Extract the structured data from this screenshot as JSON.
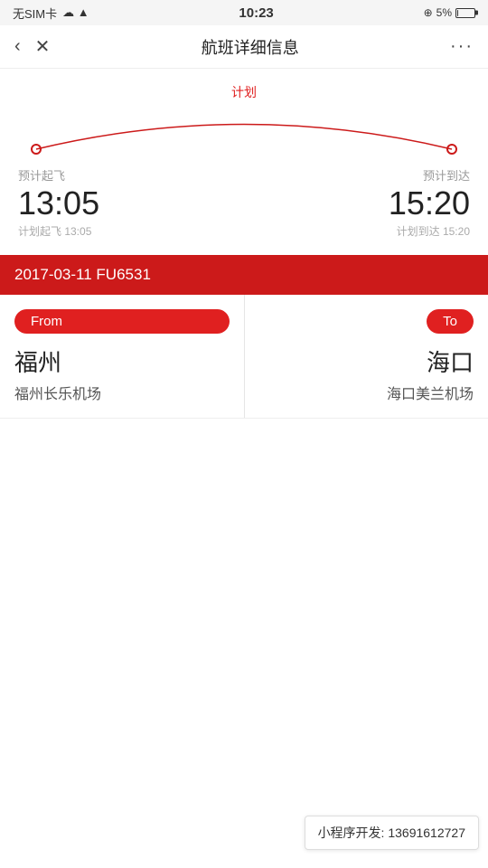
{
  "statusBar": {
    "carrier": "无SIM卡",
    "wifi": "WiFi",
    "time": "10:23",
    "battery_percent": "5%"
  },
  "navBar": {
    "title": "航班详细信息",
    "back_label": "‹",
    "close_label": "✕",
    "more_label": "···"
  },
  "flightArc": {
    "plan_label": "计划",
    "depart_label": "预计起飞",
    "arrive_label": "预计到达",
    "depart_time": "13:05",
    "arrive_time": "15:20",
    "depart_sub": "计划起飞 13:05",
    "arrive_sub": "计划到达 15:20"
  },
  "flightInfo": {
    "date_flight": "2017-03-11 FU6531"
  },
  "fromTo": {
    "from_badge": "From",
    "to_badge": "To",
    "from_city": "福州",
    "from_airport": "福州长乐机场",
    "to_city": "海口",
    "to_airport": "海口美兰机场"
  },
  "footer": {
    "watermark": "小程序开发: 13691612727"
  }
}
